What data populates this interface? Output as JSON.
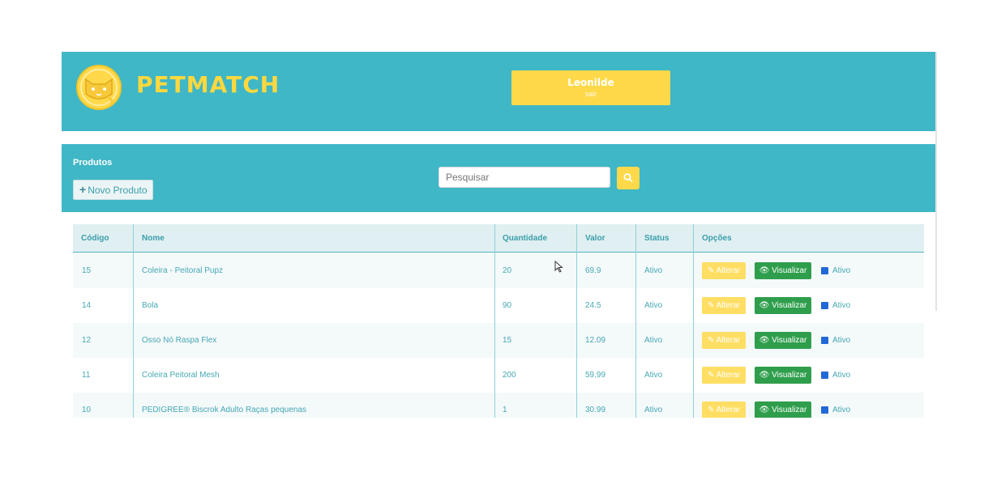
{
  "app": {
    "brand": "PETMATCH"
  },
  "user": {
    "name": "Leonilde",
    "exit_label": "sair"
  },
  "toolbar": {
    "title": "Produtos",
    "new_button_label": "Novo Produto",
    "search_placeholder": "Pesquisar"
  },
  "table": {
    "columns": [
      "Código",
      "Nome",
      "Quantidade",
      "Valor",
      "Status",
      "Opções"
    ],
    "rows": [
      {
        "code": "15",
        "name": "Coleira - Peitoral Pupz",
        "quantity": "20",
        "value": "69.9",
        "status": "Ativo",
        "edit_label": "Alterar",
        "view_label": "Visualizar",
        "active_label": "Ativo"
      },
      {
        "code": "14",
        "name": "Bola",
        "quantity": "90",
        "value": "24.5",
        "status": "Ativo",
        "edit_label": "Alterar",
        "view_label": "Visualizar",
        "active_label": "Ativo"
      },
      {
        "code": "12",
        "name": "Osso Nó Raspa Flex",
        "quantity": "15",
        "value": "12.09",
        "status": "Ativo",
        "edit_label": "Alterar",
        "view_label": "Visualizar",
        "active_label": "Ativo"
      },
      {
        "code": "11",
        "name": "Coleira Peitoral Mesh",
        "quantity": "200",
        "value": "59.99",
        "status": "Ativo",
        "edit_label": "Alterar",
        "view_label": "Visualizar",
        "active_label": "Ativo"
      },
      {
        "code": "10",
        "name": "PEDIGREE® Biscrok Adulto Raças pequenas",
        "quantity": "1",
        "value": "30.99",
        "status": "Ativo",
        "edit_label": "Alterar",
        "view_label": "Visualizar",
        "active_label": "Ativo"
      }
    ]
  },
  "icons": {
    "logo": "cat-logo-icon",
    "new": "plus-icon",
    "search": "search-icon",
    "edit": "pencil-icon",
    "view": "eye-icon",
    "active": "checkbox-icon",
    "cursor": "mouse-pointer-icon"
  },
  "colors": {
    "primary": "#3fb7c6",
    "accent": "#ffd94a",
    "view_button": "#2f9e4c",
    "checkbox": "#2169d6",
    "text": "#45a8b5"
  }
}
